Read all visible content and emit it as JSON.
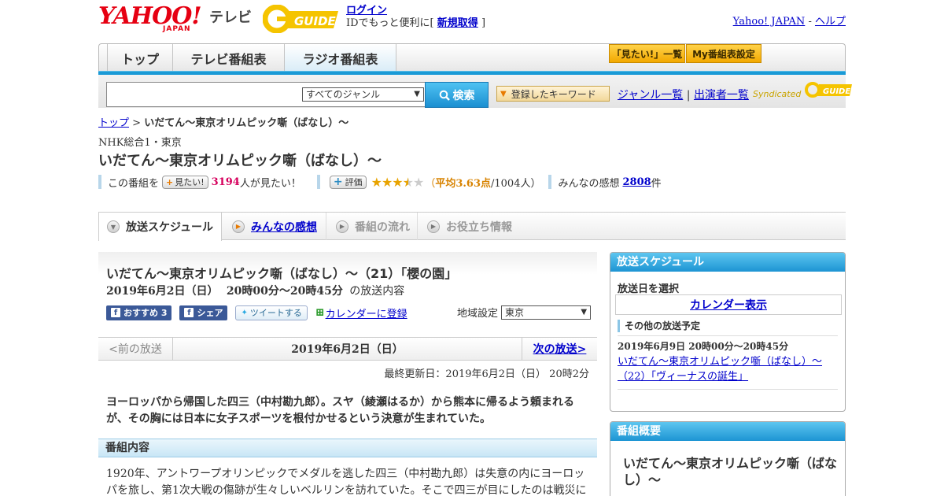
{
  "header": {
    "yahoo_logo": "YAHOO!",
    "yahoo_japan": "JAPAN",
    "tv_label": "テレビ",
    "gguide_logo": "G-GUIDE",
    "login_link": "ログイン",
    "login_text_prefix": "IDでもっと便利に[",
    "signup_link": "新規取得",
    "login_text_suffix": "]",
    "yahoo_japan_link": "Yahoo! JAPAN",
    "separator": "-",
    "help_link": "ヘルプ"
  },
  "nav": {
    "tabs": [
      "トップ",
      "テレビ番組表",
      "ラジオ番組表"
    ],
    "mitai_button": "「見たい!」一覧",
    "my_schedule_button": "My番組表設定"
  },
  "search": {
    "placeholder": "",
    "genre_selected": "すべてのジャンル",
    "search_button": "検索",
    "keyword_button": "登録したキーワード",
    "genre_list_link": "ジャンル一覧",
    "link_separator": "|",
    "performer_list_link": "出演者一覧",
    "syndicated_label": "Syndicated"
  },
  "breadcrumb": {
    "top": "トップ",
    "separator": ">",
    "current": "いだてん～東京オリムピック噺（ばなし）～"
  },
  "program": {
    "channel": "NHK総合1・東京",
    "title": "いだてん～東京オリムピック噺（ばなし）～",
    "mitai_prefix": "この番組を",
    "mitai_button": "見たい!",
    "mitai_count": "3194",
    "mitai_suffix": "人が見たい！",
    "rate_button": "評価",
    "rating": 3.63,
    "rating_text_open": "（",
    "rating_avg_label": "平均3.63点",
    "rating_count": "/1004人）",
    "review_prefix": "みんなの感想",
    "review_count": "2808",
    "review_suffix": "件"
  },
  "tabs": {
    "schedule": "放送スケジュール",
    "reviews": "みんなの感想",
    "flow": "番組の流れ",
    "info": "お役立ち情報"
  },
  "episode": {
    "title": "いだてん～東京オリムピック噺（ばなし）～（21）「櫻の園」",
    "date": "2019年6月2日（日）",
    "time": "20時00分～20時45分",
    "date_suffix": "の放送内容",
    "fb_recommend": "おすすめ 3",
    "fb_share": "シェア",
    "tweet": "ツイートする",
    "calendar_link": "カレンダーに登録",
    "region_label": "地域設定",
    "region_selected": "東京"
  },
  "date_nav": {
    "prev": "<前の放送",
    "current": "2019年6月2日（日）",
    "next": "次の放送>"
  },
  "last_updated": "最終更新日：2019年6月2日（日） 20時2分",
  "summary": "ヨーロッパから帰国した四三（中村勘九郎）。スヤ（綾瀬はるか）から熊本に帰るよう頼まれるが、その胸には日本に女子スポーツを根付かせるという決意が生まれていた。",
  "detail": {
    "section_title": "番組内容",
    "text": "1920年、アントワープオリンピックでメダルを逃した四三（中村勘九郎）は失意の内にヨーロッパを旅し、第1次大戦の傷跡が生々しいベルリンを訪れていた。そこで四三が目にしたのは戦災に"
  },
  "sidebar": {
    "schedule_head": "放送スケジュール",
    "select_date_label": "放送日を選択",
    "calendar_button": "カレンダー表示",
    "other_head": "その他の放送予定",
    "other_date": "2019年6月9日 20時00分～20時45分",
    "other_link": "いだてん～東京オリムピック噺（ばなし）～（22）「ヴィーナスの誕生」",
    "overview_head": "番組概要",
    "overview_title": "いだてん～東京オリムピック噺（ばなし）～"
  },
  "colors": {
    "accent_blue": "#1a9ad6",
    "yahoo_red": "#e60012",
    "gguide_yellow": "#f5c400",
    "mitai_pink": "#d6005d",
    "rating_orange": "#d88300"
  }
}
